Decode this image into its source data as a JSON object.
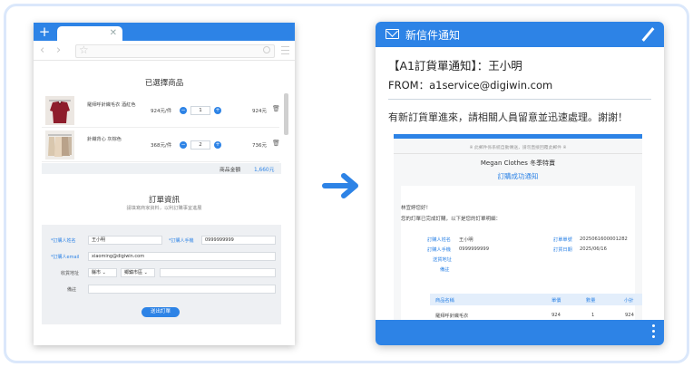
{
  "browser": {
    "new_tab_label": "+",
    "tab_close": "✕"
  },
  "cart": {
    "title": "已選擇商品",
    "items": [
      {
        "name": "羅拜呼針織毛衣 酒紅色",
        "price": "924元/件",
        "qty": "1",
        "subtotal": "924元"
      },
      {
        "name": "針織背心 灰棕色",
        "price": "368元/件",
        "qty": "2",
        "subtotal": "736元"
      }
    ],
    "total_label": "商品金額",
    "total_value": "1,660元"
  },
  "order": {
    "title": "訂單資訊",
    "subtitle": "請填寫商家資料，以利訂購事宜進展",
    "buyer_name_label": "*訂購人姓名",
    "buyer_name_value": "王小明",
    "buyer_phone_label": "*訂購人手機",
    "buyer_phone_value": "0999999999",
    "buyer_email_label": "*訂購人email",
    "buyer_email_value": "xiaoming@digiwin.com",
    "address_label": "收貨地址",
    "city_select": "縣市",
    "district_select": "鄉鎮市區",
    "note_label": "備註",
    "submit_label": "送出訂單"
  },
  "email": {
    "header_title": "新信件通知",
    "subject": "【A1訂貨單通知】：王小明",
    "from": "FROM：a1service@digiwin.com",
    "body": "有新訂貨單進來，請相關人員留意並迅速處理。謝謝！",
    "preview": {
      "notice": "※ 此郵件係系統自動傳送，請勿直接回覆此郵件 ※",
      "store": "Megan Clothes 冬季特賣",
      "success": "訂購成功通知",
      "greeting": "林宜婷您好！",
      "greeting2": "您的訂單已完成訂購，以下是您的訂單明細：",
      "info": {
        "name_k": "訂購人姓名",
        "name_v": "王小明",
        "phone_k": "訂購人手機",
        "phone_v": "0999999999",
        "addr_k": "送貨地址",
        "note_k": "備註",
        "no_k": "訂單單號",
        "no_v": "2025061600001282",
        "date_k": "訂貨日期",
        "date_v": "2025/06/16"
      },
      "table": {
        "col_name": "商品名稱",
        "col_price": "單價",
        "col_qty": "數量",
        "col_sub": "小計",
        "row_name": "羅拜呼針織毛衣",
        "row_price": "924",
        "row_qty": "1",
        "row_sub": "924"
      }
    }
  }
}
